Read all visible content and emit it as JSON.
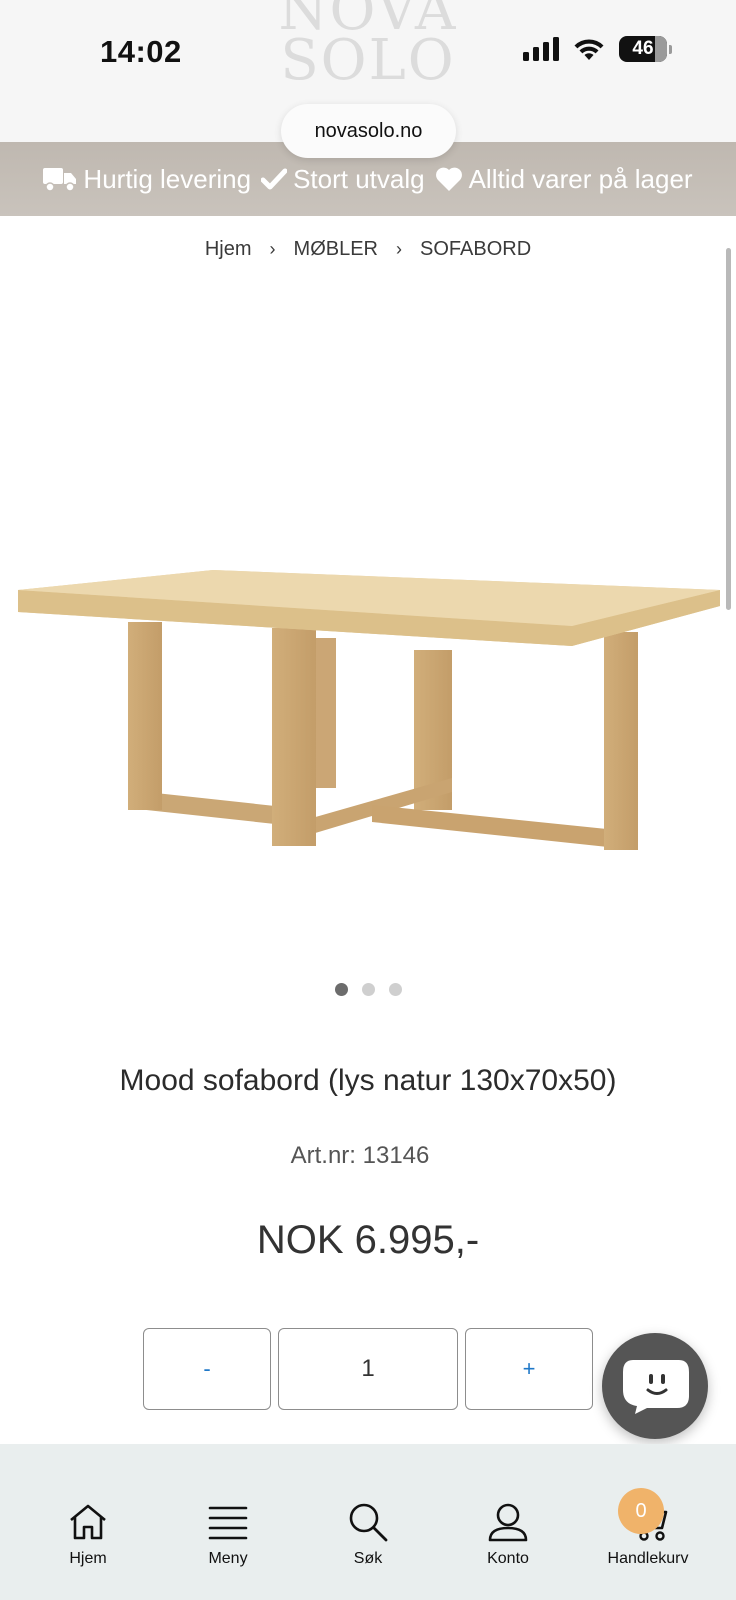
{
  "status_bar": {
    "time": "14:02",
    "battery": "46"
  },
  "header": {
    "logo_line1": "NOVA",
    "logo_line2": "SOLO",
    "url": "novasolo.no"
  },
  "usp": [
    {
      "icon": "truck-icon",
      "label": "Hurtig levering"
    },
    {
      "icon": "check-icon",
      "label": "Stort utvalg"
    },
    {
      "icon": "heart-icon",
      "label": "Alltid varer på lager"
    }
  ],
  "breadcrumb": [
    "Hjem",
    "MØBLER",
    "SOFABORD"
  ],
  "carousel": {
    "slides": 3,
    "active": 1
  },
  "product": {
    "title": "Mood sofabord (lys natur 130x70x50)",
    "art_nr": "Art.nr: 13146",
    "price": "NOK 6.995,-"
  },
  "quantity": {
    "minus": "-",
    "value": "1",
    "plus": "+"
  },
  "bottom_nav": [
    {
      "icon": "home-icon",
      "label": "Hjem"
    },
    {
      "icon": "menu-icon",
      "label": "Meny"
    },
    {
      "icon": "search-icon",
      "label": "Søk"
    },
    {
      "icon": "account-icon",
      "label": "Konto"
    },
    {
      "icon": "cart-icon",
      "label": "Handlekurv",
      "badge": "0"
    }
  ],
  "colors": {
    "usp_bar": "#c5bfb8",
    "accent_blue": "#1f78c8",
    "badge": "#f0b36a",
    "nav_bg": "#e9eeee"
  }
}
